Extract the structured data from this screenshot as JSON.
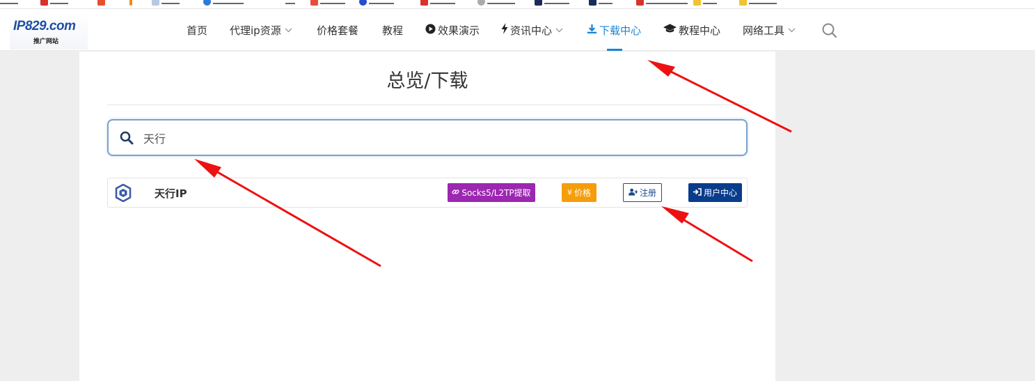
{
  "header": {
    "logo_text": "IP829.com",
    "logo_sub": "推广网站",
    "nav": [
      {
        "label": "首页",
        "icon": "",
        "has_caret": false
      },
      {
        "label": "代理ip资源",
        "icon": "",
        "has_caret": true
      },
      {
        "label": "价格套餐",
        "icon": "",
        "has_caret": false
      },
      {
        "label": "教程",
        "icon": "",
        "has_caret": false
      },
      {
        "label": "效果演示",
        "icon": "play-circle-icon",
        "has_caret": false
      },
      {
        "label": "资讯中心",
        "icon": "bolt-icon",
        "has_caret": true
      },
      {
        "label": "下载中心",
        "icon": "download-icon",
        "has_caret": false,
        "active": true
      },
      {
        "label": "教程中心",
        "icon": "graduation-cap-icon",
        "has_caret": false
      },
      {
        "label": "网络工具",
        "icon": "",
        "has_caret": true
      }
    ],
    "search_icon": "search-icon"
  },
  "main": {
    "title": "总览/下载",
    "search": {
      "value": "天行",
      "icon": "search-icon"
    },
    "results": [
      {
        "name": "天行IP",
        "logo_icon": "tianxing-logo-icon",
        "badges": [
          {
            "label": "Socks5/L2TP提取",
            "icon": "link-icon",
            "color": "#9c27b0"
          },
          {
            "label": "价格",
            "icon": "yen-icon",
            "color": "#f59d0b"
          },
          {
            "label": "注册",
            "icon": "user-plus-icon",
            "color": "#1b4a8a"
          },
          {
            "label": "用户中心",
            "icon": "sign-in-icon",
            "color": "#0a3c8c"
          }
        ]
      }
    ]
  },
  "colors": {
    "accent": "#1a84d6",
    "annotation_arrow": "#ee1111",
    "page_bg": "#eeeeee"
  }
}
